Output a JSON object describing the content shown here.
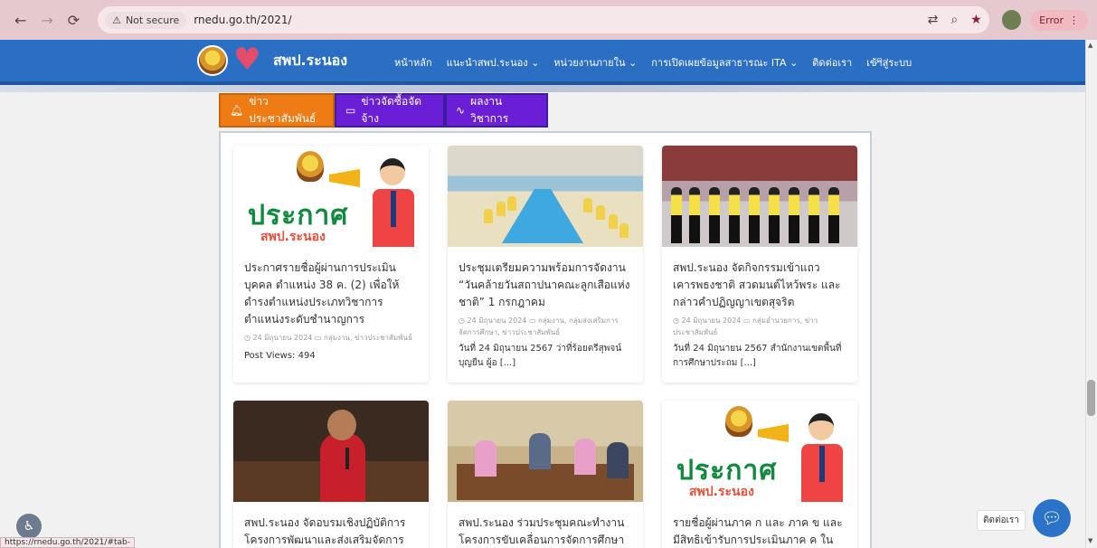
{
  "browser": {
    "not_secure_label": "Not secure",
    "url": "rnedu.go.th/2021/",
    "error_label": "Error",
    "status_url": "https://rnedu.go.th/2021/#tab-"
  },
  "site": {
    "name": "สพป.ระนอง",
    "menu": [
      "หน้าหลัก",
      "แนะนำสพป.ระนอง ⌄",
      "หน่วยงานภายใน ⌄",
      "การเปิดเผยข้อมูลสาธารณะ ITA ⌄",
      "ติดต่อเรา",
      "เข้าสู่ระบบ"
    ]
  },
  "tabs": [
    {
      "label": "ข่าวประชาสัมพันธ์",
      "icon": "bell-icon"
    },
    {
      "label": "ข่าวจัดซื้อจัดจ้าง",
      "icon": "monitor-icon"
    },
    {
      "label": "ผลงานวิชาการ",
      "icon": "pulse-icon"
    }
  ],
  "cards": [
    {
      "title": "ประกาศรายชื่อผู้ผ่านการประเมินบุคคล ตำแหน่ง 38 ค. (2) เพื่อให้ดำรงตำแหน่งประเภทวิชาการ ตำแหน่งระดับชำนาญการ",
      "meta": "◷ 24 มิถุนายน 2024 ▭ กลุ่มงาน, ข่าวประชาสัมพันธ์",
      "views": "Post Views: 494",
      "thumb_big": "ประกาศ",
      "thumb_sub": "สพป.ระนอง"
    },
    {
      "title": "ประชุมเตรียมความพร้อมการจัดงาน “วันคล้ายวันสถาปนาคณะลูกเสือแห่งชาติ” 1 กรกฎาคม",
      "meta": "◷ 24 มิถุนายน 2024 ▭ กลุ่มงาน, กลุ่มส่งเสริมการจัดการศึกษา, ข่าวประชาสัมพันธ์",
      "excerpt": "วันที่ 24 มิถุนายน 2567 ว่าที่ร้อยตรีสุพจน์ บุญยืน ผู้อ [...]"
    },
    {
      "title": "สพป.ระนอง จัดกิจกรรมเข้าแถวเคารพธงชาติ สวดมนต์ไหว้พระ และกล่าวคำปฏิญญาเขตสุจริต",
      "meta": "◷ 24 มิถุนายน 2024 ▭ กลุ่มอำนวยการ, ข่าวประชาสัมพันธ์",
      "excerpt": "วันที่ 24 มิถุนายน 2567 สำนักงานเขตพื้นที่การศึกษาประถม [...]"
    },
    {
      "title": "สพป.ระนอง จัดอบรมเชิงปฏิบัติการ โครงการพัฒนาและส่งเสริมจัดการ"
    },
    {
      "title": "สพป.ระนอง ร่วมประชุมคณะทำงาน โครงการขับเคลื่อนการจัดการศึกษาและ"
    },
    {
      "title": "รายชื่อผู้ผ่านภาค ก และ ภาค ข และมีสิทธิเข้ารับการประเมินภาค ค ในการ",
      "thumb_big": "ประกาศ",
      "thumb_sub": "สพป.ระนอง"
    }
  ],
  "floating": {
    "contact_label": "ติดต่อเรา"
  },
  "colors": {
    "header_blue": "#2a6fc4",
    "tab_active": "#ee7b13",
    "tab_inactive": "#6a1fd6",
    "browser_chrome": "#e6c9cf"
  }
}
